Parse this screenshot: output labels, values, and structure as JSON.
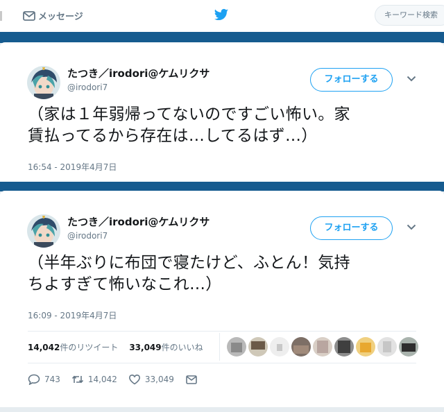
{
  "nav": {
    "messages_label": "メッセージ",
    "search_placeholder": "キーワード検索",
    "bird_icon": "twitter-bird-icon",
    "accent": "#1da1f2",
    "band_color": "#165b8f"
  },
  "tweets": [
    {
      "name": "たつき／irodori@ケムリクサ",
      "handle": "@irodori7",
      "follow_label": "フォローする",
      "text_line1": "（家は１年弱帰ってないのですごい怖い。家",
      "text_line2": "賃払ってるから存在は…してるはず…）",
      "timestamp": "16:54 - 2019年4月7日"
    },
    {
      "name": "たつき／irodori@ケムリクサ",
      "handle": "@irodori7",
      "follow_label": "フォローする",
      "text_line1": "（半年ぶりに布団で寝たけど、ふとん！気持",
      "text_line2": "ちよすぎて怖いなこれ…）",
      "timestamp": "16:09 - 2019年4月7日",
      "retweet_count": "14,042",
      "retweet_label": "件のリツイート",
      "like_count": "33,049",
      "like_label": "件のいいね",
      "reply_count": "743",
      "retweet_action_count": "14,042",
      "like_action_count": "33,049"
    }
  ]
}
